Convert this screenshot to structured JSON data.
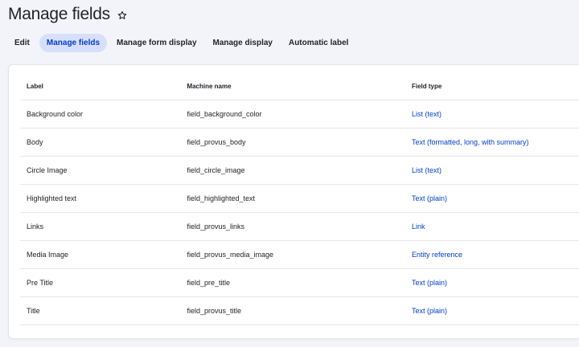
{
  "page": {
    "title": "Manage fields"
  },
  "tabs": [
    {
      "label": "Edit",
      "active": false
    },
    {
      "label": "Manage fields",
      "active": true
    },
    {
      "label": "Manage form display",
      "active": false
    },
    {
      "label": "Manage display",
      "active": false
    },
    {
      "label": "Automatic label",
      "active": false
    }
  ],
  "table": {
    "headers": {
      "label": "Label",
      "machine_name": "Machine name",
      "field_type": "Field type"
    },
    "rows": [
      {
        "label": "Background color",
        "machine_name": "field_background_color",
        "field_type": "List (text)"
      },
      {
        "label": "Body",
        "machine_name": "field_provus_body",
        "field_type": "Text (formatted, long, with summary)"
      },
      {
        "label": "Circle Image",
        "machine_name": "field_circle_image",
        "field_type": "List (text)"
      },
      {
        "label": "Highlighted text",
        "machine_name": "field_highlighted_text",
        "field_type": "Text (plain)"
      },
      {
        "label": "Links",
        "machine_name": "field_provus_links",
        "field_type": "Link"
      },
      {
        "label": "Media Image",
        "machine_name": "field_provus_media_image",
        "field_type": "Entity reference"
      },
      {
        "label": "Pre Title",
        "machine_name": "field_pre_title",
        "field_type": "Text (plain)"
      },
      {
        "label": "Title",
        "machine_name": "field_provus_title",
        "field_type": "Text (plain)"
      }
    ]
  },
  "colors": {
    "accent": "#003ecc",
    "active_tab_bg": "#d8dffb",
    "page_bg": "#f3f4f9"
  },
  "icons": {
    "favorite": "star-outline-icon"
  }
}
